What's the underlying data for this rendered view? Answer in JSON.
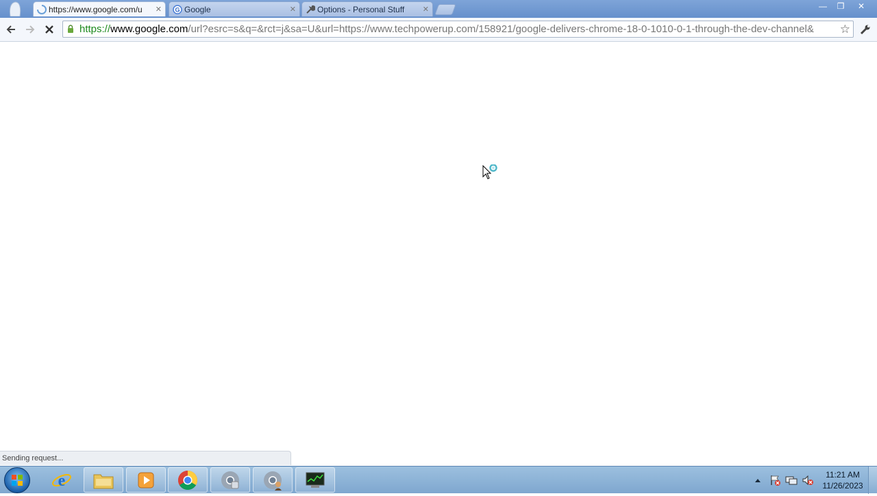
{
  "browser": {
    "tabs": [
      {
        "title": "https://www.google.com/u",
        "active": true,
        "icon": "loading-spinner-icon"
      },
      {
        "title": "Google",
        "active": false,
        "icon": "google-favicon-icon"
      },
      {
        "title": "Options - Personal Stuff",
        "active": false,
        "icon": "wrench-icon"
      }
    ],
    "address_bar": {
      "scheme": "https://",
      "host": "www.google.com",
      "path": "/url?esrc=s&q=&rct=j&sa=U&url=https://www.techpowerup.com/158921/google-delivers-chrome-18-0-1010-0-1-through-the-dev-channel&"
    },
    "status_text": "Sending request...",
    "window_controls": {
      "minimize": "—",
      "maximize": "❐",
      "close": "✕"
    }
  },
  "taskbar": {
    "pinned": [
      {
        "name": "internet-explorer",
        "label": "e"
      },
      {
        "name": "file-explorer",
        "label": ""
      },
      {
        "name": "media-player",
        "label": "▶"
      },
      {
        "name": "chrome",
        "label": ""
      },
      {
        "name": "chrome-window-2",
        "label": ""
      },
      {
        "name": "chrome-window-3",
        "label": ""
      },
      {
        "name": "task-manager",
        "label": ""
      }
    ],
    "clock": {
      "time": "11:21 AM",
      "date": "11/26/2023"
    }
  },
  "colors": {
    "scheme_green": "#1e8a1e",
    "taskbar": "#8fb5da",
    "titlebar": "#6f98d2"
  }
}
